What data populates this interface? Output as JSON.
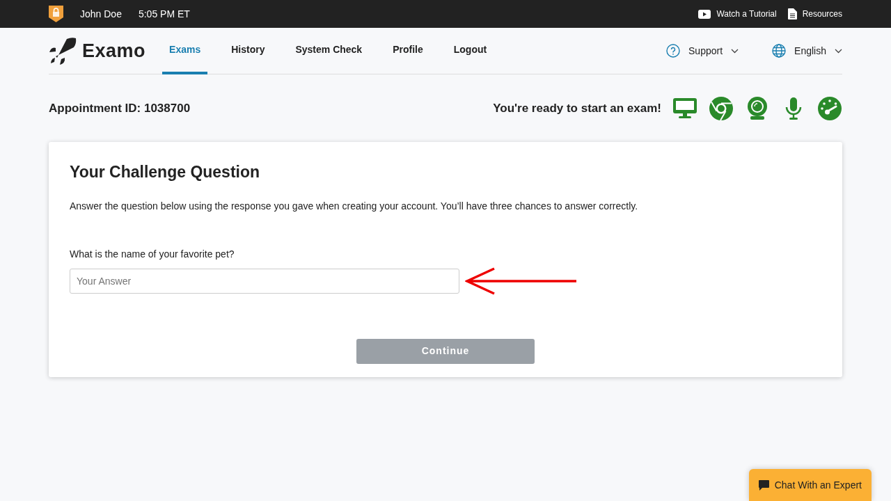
{
  "top_bar": {
    "user": "John Doe",
    "time": "5:05 PM ET",
    "links": [
      {
        "kind": "video",
        "label": "Watch a Tutorial"
      },
      {
        "kind": "document",
        "label": "Resources"
      }
    ]
  },
  "navbar": {
    "brand": "Examo",
    "items": [
      {
        "label": "Exams",
        "selected": true
      },
      {
        "label": "History",
        "selected": false
      },
      {
        "label": "System Check",
        "selected": false
      },
      {
        "label": "Profile",
        "selected": false
      },
      {
        "label": "Logout",
        "selected": false
      }
    ],
    "menus": [
      {
        "kind": "help",
        "label": "Support"
      },
      {
        "kind": "globe",
        "label": "English"
      }
    ]
  },
  "appointment": "Appointment ID: 1038700",
  "ready_message": "You're ready to start an exam!",
  "system_checks": [
    {
      "kind": "monitor",
      "passed": true
    },
    {
      "kind": "browser",
      "passed": true
    },
    {
      "kind": "webcam",
      "passed": true
    },
    {
      "kind": "microphone",
      "passed": true
    },
    {
      "kind": "speed",
      "passed": true
    }
  ],
  "card": {
    "title": "Your Challenge Question",
    "description": "Answer the question below using the response you gave when creating your account. You’ll have three chances to answer correctly.",
    "question": "What is the name of your favorite pet?",
    "placeholder": "Your Answer",
    "button": {
      "label": "Continue",
      "disabled": true
    }
  },
  "chat_button": "Chat With an Expert"
}
